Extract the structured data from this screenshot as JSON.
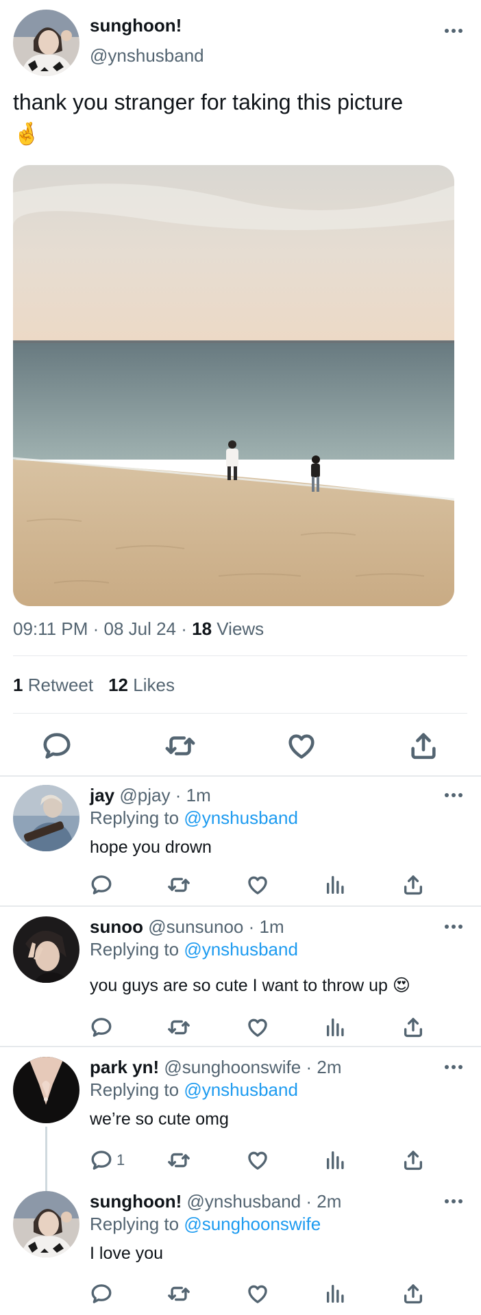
{
  "tweet": {
    "display_name": "sunghoon!",
    "handle": "@ynshusband",
    "text": "thank you stranger for taking this picture",
    "emoji": "🤞",
    "time": "09:11 PM",
    "date": "08 Jul 24",
    "views_count": "18",
    "views_label": "Views",
    "retweets_count": "1",
    "retweets_label": "Retweet",
    "likes_count": "12",
    "likes_label": "Likes"
  },
  "replies": [
    {
      "name": "jay",
      "handle": "@pjay",
      "time": "1m",
      "replying_prefix": "Replying to",
      "replying_to": "@ynshusband",
      "text": "hope you drown",
      "reply_count": ""
    },
    {
      "name": "sunoo",
      "handle": "@sunsunoo",
      "time": "1m",
      "replying_prefix": "Replying to",
      "replying_to": "@ynshusband",
      "text": "you guys are so cute I want to throw up",
      "emoji": "😍",
      "reply_count": ""
    },
    {
      "name": "park yn!",
      "handle": "@sunghoonswife",
      "time": "2m",
      "replying_prefix": "Replying to",
      "replying_to": "@ynshusband",
      "text": "we’re so cute omg",
      "reply_count": "1"
    },
    {
      "name": "sunghoon!",
      "handle": "@ynshusband",
      "time": "2m",
      "replying_prefix": "Replying to",
      "replying_to": "@sunghoonswife",
      "text": "I love you",
      "reply_count": ""
    }
  ],
  "colors": {
    "text_primary": "#0f1419",
    "text_secondary": "#536471",
    "link": "#1d9bf0",
    "divider": "#e6e9ec"
  },
  "icons": [
    "more-icon",
    "reply-icon",
    "retweet-icon",
    "like-icon",
    "views-icon",
    "share-icon"
  ]
}
